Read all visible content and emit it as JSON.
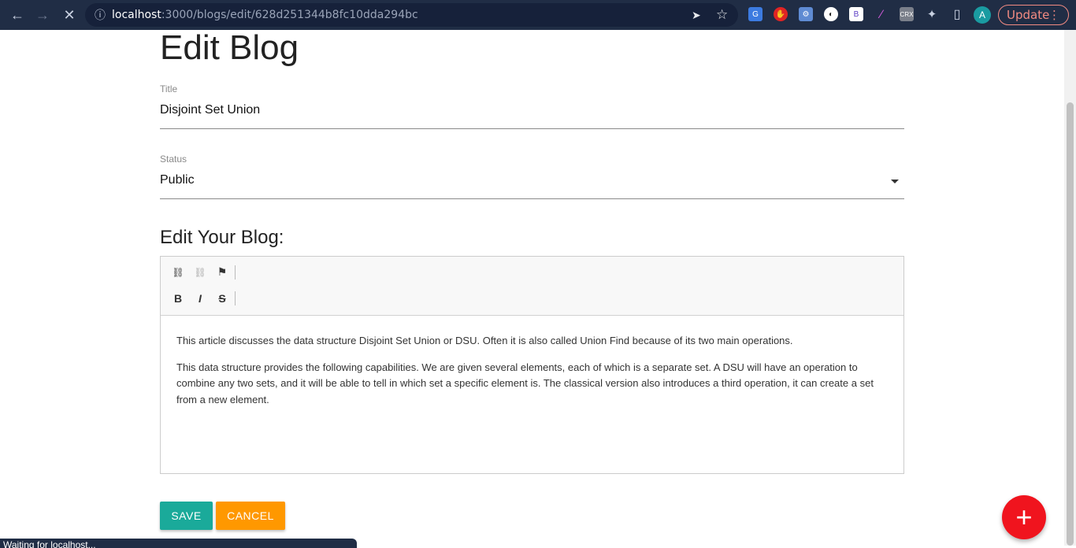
{
  "browser": {
    "back_icon": "←",
    "forward_icon": "→",
    "reload_icon": "✕",
    "info_icon": "ⓘ",
    "url_host": "localhost",
    "url_path": ":3000/blogs/edit/628d251344b8fc10dda294bc",
    "send_icon": "➤",
    "star_icon": "☆",
    "avatar_letter": "A",
    "update_label": "Update",
    "update_menu_icon": "⋮",
    "extensions": [
      {
        "name": "translate",
        "label": "G",
        "color": "#3c7be0"
      },
      {
        "name": "adblock",
        "label": "✋",
        "color": "#e02424"
      },
      {
        "name": "ext-3",
        "label": "⚙",
        "color": "#5f8bd3"
      },
      {
        "name": "ext-4",
        "label": "◐",
        "color": "#ffffff"
      },
      {
        "name": "ext-5",
        "label": "B",
        "color": "#ffffff"
      },
      {
        "name": "ext-6",
        "label": "∕",
        "color": "#d85ce0"
      },
      {
        "name": "crx",
        "label": "CRX",
        "color": "#7a7f8a"
      },
      {
        "name": "puzzle",
        "label": "✦",
        "color": "#c9d1e1"
      },
      {
        "name": "sidebar",
        "label": "▯",
        "color": "#c9d1e1"
      }
    ]
  },
  "page": {
    "title": "Edit Blog",
    "title_field": {
      "label": "Title",
      "value": "Disjoint Set Union"
    },
    "status_field": {
      "label": "Status",
      "value": "Public"
    },
    "editor_heading": "Edit Your Blog:",
    "toolbar": {
      "link_icon": "⛓",
      "unlink_icon": "⛓",
      "anchor_icon": "⚑",
      "bold_label": "B",
      "italic_label": "I",
      "strike_label": "S"
    },
    "content": {
      "paragraph1": "This article discusses the data structure  Disjoint Set Union or DSU. Often it is also called Union Find because of its two main operations.",
      "paragraph2": "This data structure provides the following capabilities. We are given several elements, each of which is a separate set. A DSU will have an operation to combine any two sets, and it will be able to tell in which set a specific element is. The classical version also introduces a third operation, it can create a set from a new element."
    },
    "save_label": "SAVE",
    "cancel_label": "CANCEL",
    "fab_icon": "+",
    "status_text": "Waiting for localhost..."
  }
}
